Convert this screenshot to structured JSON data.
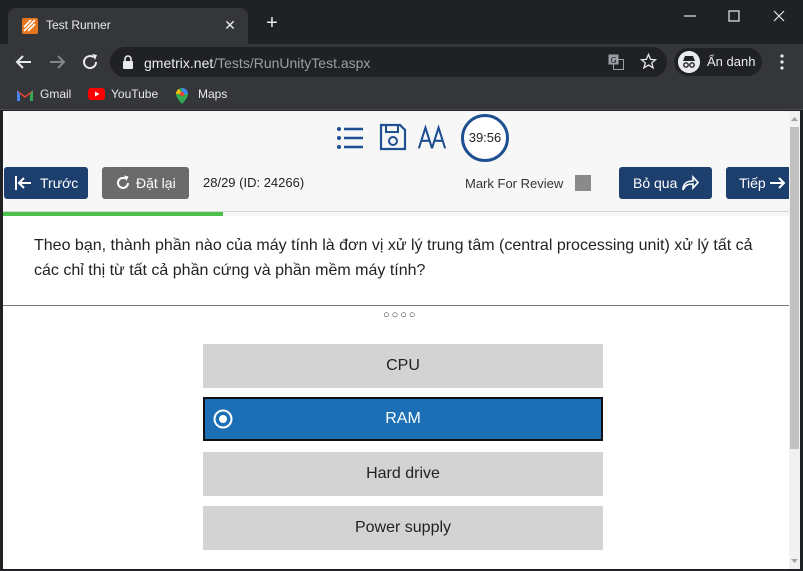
{
  "browser": {
    "tab_title": "Test Runner",
    "url_host": "gmetrix.net",
    "url_path": "/Tests/RunUnityTest.aspx",
    "profile_label": "Ẩn danh",
    "bookmarks": [
      {
        "label": "Gmail",
        "icon": "gmail-icon"
      },
      {
        "label": "YouTube",
        "icon": "youtube-icon"
      },
      {
        "label": "Maps",
        "icon": "maps-icon"
      }
    ]
  },
  "test": {
    "timer": "39:56",
    "prev_label": "Trước",
    "reset_label": "Đặt lại",
    "counter": "28/29 (ID: 24266)",
    "review_label": "Mark For Review",
    "skip_label": "Bỏ qua",
    "next_label": "Tiếp",
    "progress_percent": 28,
    "question": "Theo bạn, thành phần nào của máy tính là đơn vị xử lý trung tâm (central processing unit) xử lý tất cả các chỉ thị từ tất cả phần cứng và phần mềm máy tính?",
    "pager_dots": "○○○○",
    "answers": [
      "CPU",
      "RAM",
      "Hard drive",
      "Power supply"
    ],
    "selected_answer": "RAM"
  },
  "colors": {
    "primary": "#1d3f6e",
    "selected": "#1c6fb5",
    "progress": "#4cc24c",
    "timer_ring": "#1d4f91"
  }
}
